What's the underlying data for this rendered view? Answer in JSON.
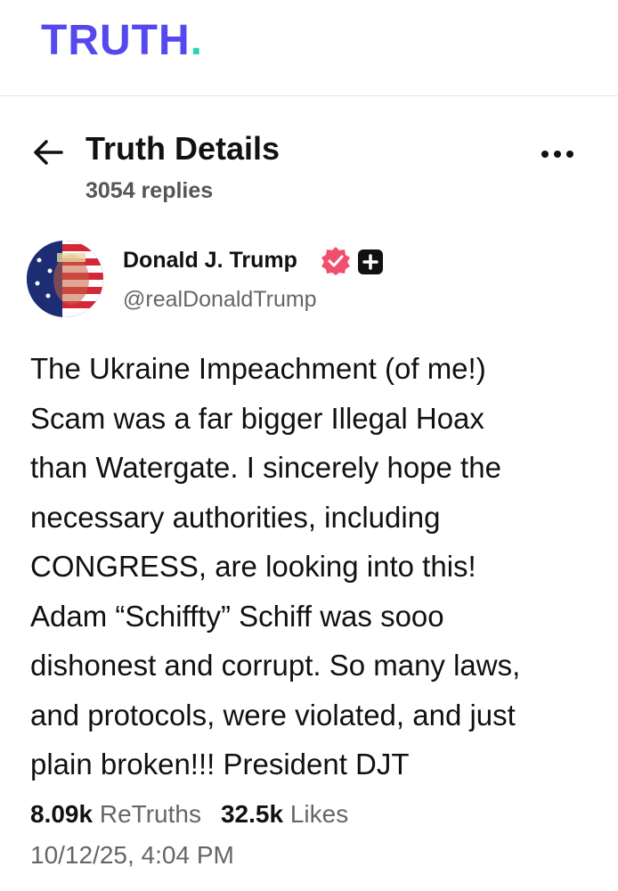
{
  "brand": {
    "logo_text": "TRUTH",
    "logo_dot": "."
  },
  "header": {
    "title": "Truth Details",
    "replies": "3054 replies",
    "back_icon": "arrow-left-icon",
    "more_icon": "ellipsis-icon"
  },
  "author": {
    "name": "Donald J. Trump",
    "handle": "@realDonaldTrump",
    "verified_icon": "verified-badge-icon",
    "verified_color": "#f0506e",
    "plus_icon": "plus-badge-icon"
  },
  "post": {
    "text": "The Ukraine Impeachment (of me!)\nScam was a far bigger Illegal Hoax\nthan Watergate. I sincerely hope the\nnecessary authorities, including\nCONGRESS, are looking into this!\nAdam “Schiffty” Schiff was sooo\ndishonest and corrupt. So many laws,\nand protocols, were violated, and just\nplain broken!!! President DJT"
  },
  "stats": {
    "retruths_count": "8.09k",
    "retruths_label": "ReTruths",
    "likes_count": "32.5k",
    "likes_label": "Likes"
  },
  "timestamp": "10/12/25, 4:04 PM",
  "colors": {
    "brand": "#5448ee",
    "brand_accent": "#2bd4b8",
    "text": "#111111",
    "muted": "#666666"
  }
}
